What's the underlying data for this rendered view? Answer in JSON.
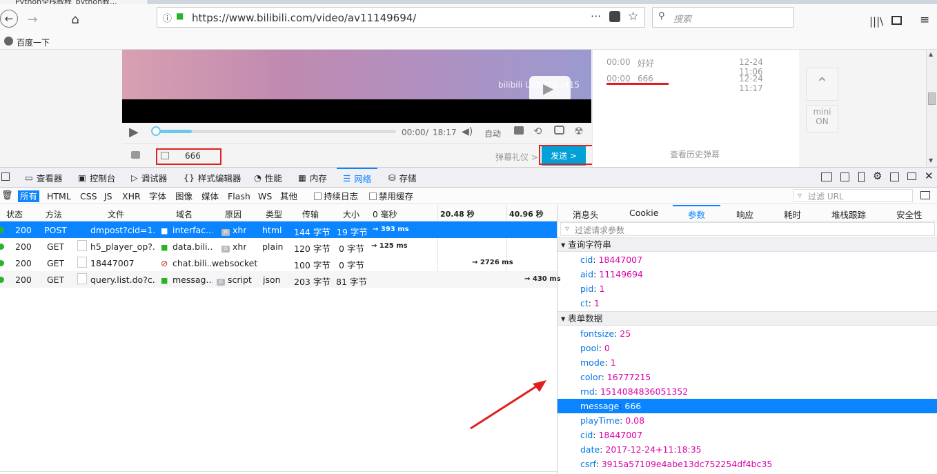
{
  "browser": {
    "tab_title": "Python全栈教程_python教...",
    "url": "https://www.bilibili.com/video/av11149694/",
    "search_placeholder": "搜索",
    "bookmark": "百度一下"
  },
  "video": {
    "watermark": "bilibili UID:1603415",
    "time_current": "00:00",
    "time_sep": "/",
    "time_total": "18:17",
    "quality": "自动",
    "progress": 0.0
  },
  "danmaku": {
    "input_value": "666",
    "etiquette": "弹幕礼仪 >",
    "send_button": "发送 >",
    "history": "查看历史弹幕",
    "list": [
      {
        "time": "00:00",
        "text": "好好",
        "date": "12-24 11:06"
      },
      {
        "time": "00:00",
        "text": "666",
        "date": "12-24 11:17"
      }
    ]
  },
  "side": {
    "mini_label": "mini",
    "mini_state": "ON"
  },
  "devtools": {
    "tabs": [
      {
        "label": "查看器",
        "icon": "inspector-icon"
      },
      {
        "label": "控制台",
        "icon": "console-icon"
      },
      {
        "label": "调试器",
        "icon": "debugger-icon"
      },
      {
        "label": "样式编辑器",
        "icon": "style-editor-icon"
      },
      {
        "label": "性能",
        "icon": "performance-icon"
      },
      {
        "label": "内存",
        "icon": "memory-icon"
      },
      {
        "label": "网络",
        "icon": "network-icon"
      },
      {
        "label": "存储",
        "icon": "storage-icon"
      }
    ],
    "active_tab": "网络",
    "filters": [
      "所有",
      "HTML",
      "CSS",
      "JS",
      "XHR",
      "字体",
      "图像",
      "媒体",
      "Flash",
      "WS",
      "其他"
    ],
    "active_filter": "所有",
    "persist_logs": "持续日志",
    "disable_cache": "禁用缓存",
    "filter_url_placeholder": "过滤 URL",
    "columns": [
      "状态",
      "方法",
      "文件",
      "域名",
      "原因",
      "类型",
      "传输",
      "大小"
    ],
    "timeline_ticks": [
      "0 毫秒",
      "20.48 秒",
      "40.96 秒"
    ],
    "requests": [
      {
        "status": "200",
        "method": "POST",
        "file": "dmpost?cid=1...",
        "domain": "interfac...",
        "cause": "xhr",
        "type": "html",
        "transferred": "144 字节",
        "size": "19 字节",
        "timing": "→ 393 ms",
        "selected": true
      },
      {
        "status": "200",
        "method": "GET",
        "file": "h5_player_op?...",
        "domain": "data.bili...",
        "cause": "xhr",
        "type": "plain",
        "transferred": "120 字节",
        "size": "0 字节",
        "timing": "→ 125 ms",
        "selected": false
      },
      {
        "status": "200",
        "method": "GET",
        "file": "18447007",
        "domain": "chat.bili...",
        "cause": "websocket",
        "type": "",
        "transferred": "100 字节",
        "size": "0 字节",
        "timing": "→ 2726 ms",
        "selected": false
      },
      {
        "status": "200",
        "method": "GET",
        "file": "query.list.do?c...",
        "domain": "messag...",
        "cause": "script",
        "type": "json",
        "transferred": "203 字节",
        "size": "81 字节",
        "timing": "→ 430 ms",
        "selected": false
      }
    ],
    "detail_tabs": [
      "消息头",
      "Cookie",
      "参数",
      "响应",
      "耗时",
      "堆栈跟踪",
      "安全性"
    ],
    "active_detail_tab": "参数",
    "params_filter_placeholder": "过滤请求参数",
    "query_section": "查询字符串",
    "query_params": [
      {
        "key": "cid",
        "value": "18447007"
      },
      {
        "key": "aid",
        "value": "11149694"
      },
      {
        "key": "pid",
        "value": "1"
      },
      {
        "key": "ct",
        "value": "1"
      }
    ],
    "form_section": "表单数据",
    "form_params": [
      {
        "key": "fontsize",
        "value": "25"
      },
      {
        "key": "pool",
        "value": "0"
      },
      {
        "key": "mode",
        "value": "1"
      },
      {
        "key": "color",
        "value": "16777215"
      },
      {
        "key": "rnd",
        "value": "1514084836051352"
      },
      {
        "key": "message",
        "value": "666"
      },
      {
        "key": "playTime",
        "value": "0.08"
      },
      {
        "key": "cid",
        "value": "18447007"
      },
      {
        "key": "date",
        "value": "2017-12-24+11:18:35"
      },
      {
        "key": "csrf",
        "value": "3915a57109e4abe13dc752254df4bc35"
      }
    ],
    "selected_form_param": "message"
  }
}
